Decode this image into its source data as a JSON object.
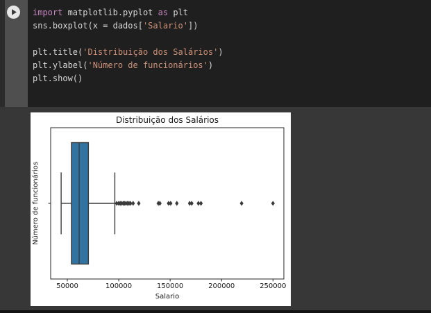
{
  "cell": {
    "run_button_icon": "play-icon",
    "code_lines": [
      [
        {
          "t": "import",
          "c": "kw"
        },
        {
          "t": " matplotlib.pyplot ",
          "c": "pl"
        },
        {
          "t": "as",
          "c": "kw"
        },
        {
          "t": " plt",
          "c": "pl"
        }
      ],
      [
        {
          "t": "sns.boxplot(x = dados[",
          "c": "pl"
        },
        {
          "t": "'Salario'",
          "c": "str"
        },
        {
          "t": "])",
          "c": "pl"
        }
      ],
      [],
      [
        {
          "t": "plt.title(",
          "c": "pl"
        },
        {
          "t": "'Distribuição dos Salários'",
          "c": "str"
        },
        {
          "t": ")",
          "c": "pl"
        }
      ],
      [
        {
          "t": "plt.ylabel(",
          "c": "pl"
        },
        {
          "t": "'Número de funcionários'",
          "c": "str"
        },
        {
          "t": ")",
          "c": "pl"
        }
      ],
      [
        {
          "t": "plt.show()",
          "c": "pl"
        }
      ]
    ],
    "colors": {
      "keyword": "#c586c0",
      "string": "#ce9178",
      "plain": "#d6d6d6",
      "code_bg": "#1f1f1f",
      "gutter_bg": "#4f4f4f",
      "page_bg": "#373737"
    }
  },
  "chart_data": {
    "type": "boxplot",
    "orientation": "horizontal",
    "title": "Distribuição dos Salários",
    "xlabel": "Salario",
    "ylabel": "Número de funcionários",
    "xlim": [
      33800,
      260600
    ],
    "xticks": [
      50000,
      100000,
      150000,
      200000,
      250000
    ],
    "grid": false,
    "legend": null,
    "box": {
      "whisker_low": 44000,
      "q1": 54000,
      "median": 61500,
      "q3": 70500,
      "whisker_high": 96200,
      "outliers": [
        98000,
        100000,
        101500,
        103000,
        104500,
        105500,
        107000,
        108500,
        110000,
        111500,
        114000,
        119500,
        138500,
        140000,
        148500,
        150500,
        156500,
        169000,
        171000,
        177500,
        180000,
        219500,
        250000
      ]
    },
    "colors": {
      "box_fill": "#3274a1",
      "line": "#3a3a3a",
      "axis": "#262626",
      "text": "#1a1a1a",
      "figure_bg": "#ffffff"
    },
    "layout": {
      "plot": {
        "l": 29,
        "t": 22,
        "r": 365,
        "b": 240
      },
      "title_y": 15,
      "xlabel_y": 268,
      "ylabel_x": 10,
      "tick_len": 3.5,
      "tick_label_dy": 13,
      "box_half": 87.5,
      "cap_half": 44.5,
      "marker_rx": 2.6,
      "marker_ry": 3.6,
      "title_size": 12,
      "label_size": 10,
      "tick_size": 10
    }
  }
}
